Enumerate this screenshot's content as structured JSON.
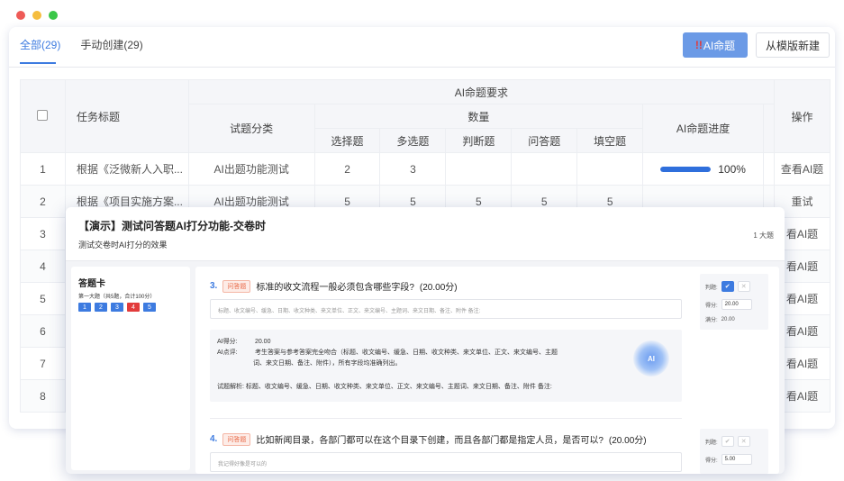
{
  "window_dots": {
    "red": "#ee5b57",
    "yellow": "#f5bd3e",
    "green": "#3ac748"
  },
  "tabs": [
    {
      "label": "全部(29)",
      "active": true
    },
    {
      "label": "手动创建(29)",
      "active": false
    }
  ],
  "toolbar": {
    "ai_mark": "!!",
    "ai_label": "AI命题",
    "template_label": "从模版新建"
  },
  "table": {
    "header": {
      "task_title": "任务标题",
      "ai_requirements": "AI命题要求",
      "category": "试题分类",
      "quantity": "数量",
      "choice": "选择题",
      "multi": "多选题",
      "judge": "判断题",
      "qa": "问答题",
      "fill": "填空题",
      "progress": "AI命题进度",
      "actions": "操作"
    },
    "rows": [
      {
        "idx": "1",
        "title": "根据《泛微新人入职...",
        "category": "AI出题功能测试",
        "choice": "2",
        "multi": "3",
        "judge": "",
        "qa": "",
        "fill": "",
        "progress": "100%",
        "progress_value": 1.0,
        "action": "查看AI题"
      },
      {
        "idx": "2",
        "title": "根据《项目实施方案...",
        "category": "AI出题功能测试",
        "choice": "5",
        "multi": "5",
        "judge": "5",
        "qa": "5",
        "fill": "5",
        "progress": "",
        "progress_value": null,
        "action": "重试"
      },
      {
        "idx": "3",
        "title": "",
        "category": "",
        "choice": "",
        "multi": "",
        "judge": "",
        "qa": "",
        "fill": "",
        "progress": "",
        "progress_value": null,
        "action": "看AI题"
      },
      {
        "idx": "4",
        "title": "",
        "category": "",
        "choice": "",
        "multi": "",
        "judge": "",
        "qa": "",
        "fill": "",
        "progress": "",
        "progress_value": null,
        "action": "看AI题"
      },
      {
        "idx": "5",
        "title": "",
        "category": "",
        "choice": "",
        "multi": "",
        "judge": "",
        "qa": "",
        "fill": "",
        "progress": "",
        "progress_value": null,
        "action": "看AI题"
      },
      {
        "idx": "6",
        "title": "",
        "category": "",
        "choice": "",
        "multi": "",
        "judge": "",
        "qa": "",
        "fill": "",
        "progress": "",
        "progress_value": null,
        "action": "看AI题"
      },
      {
        "idx": "7",
        "title": "",
        "category": "",
        "choice": "",
        "multi": "",
        "judge": "",
        "qa": "",
        "fill": "",
        "progress": "",
        "progress_value": null,
        "action": "看AI题"
      },
      {
        "idx": "8",
        "title": "",
        "category": "",
        "choice": "",
        "multi": "",
        "judge": "",
        "qa": "",
        "fill": "",
        "progress": "",
        "progress_value": null,
        "action": "看AI题"
      }
    ]
  },
  "overlay": {
    "title": "【演示】测试问答题AI打分功能-交卷时",
    "subtitle": "测试交卷时AI打分的效果",
    "count": "1 大题",
    "answer_card": {
      "heading": "答题卡",
      "section": "第一大题（共5题，合计100分）",
      "numbers": [
        {
          "n": "1",
          "color": "#3d7be0"
        },
        {
          "n": "2",
          "color": "#3d7be0"
        },
        {
          "n": "3",
          "color": "#3d7be0"
        },
        {
          "n": "4",
          "color": "#e23b3b"
        },
        {
          "n": "5",
          "color": "#3d7be0"
        }
      ]
    },
    "q3": {
      "no": "3.",
      "tag": "问答题",
      "text": "标准的收文流程一般必须包含哪些字段?",
      "score": "(20.00分)",
      "answer": "标题、收文编号、缓急、日期、收文种类、来文单位、正文、来文编号、主题词、来文日期、备注、附件 备注:",
      "ai_score_label": "AI得分:",
      "ai_score": "20.00",
      "ai_comment_label": "AI点评:",
      "ai_comment_1": "考生答案与参考答案完全吻合（标题、收文编号、缓急、日期、收文种类、来文单位、正文、来文编号、主题",
      "ai_comment_2": "词、来文日期、备注、附件），所有字段均准确列出。",
      "analysis_label": "试题解析:",
      "analysis": "标题、收文编号、缓急、日期、收文种类、来文单位、正文、来文编号、主题词、来文日期、备注、附件 备注:",
      "logo": "AI",
      "judge_label": "判题:",
      "score_label": "得分:",
      "score_value": "20.00",
      "full_label": "满分:",
      "full_value": "20.00"
    },
    "q4": {
      "no": "4.",
      "tag": "问答题",
      "text": "比如新闻目录，各部门都可以在这个目录下创建，而且各部门都是指定人员，是否可以?",
      "score": "(20.00分)",
      "answer": "我记得好像是可以的",
      "judge_label": "判题:",
      "score_label": "得分:",
      "score_value": "5.00"
    }
  }
}
